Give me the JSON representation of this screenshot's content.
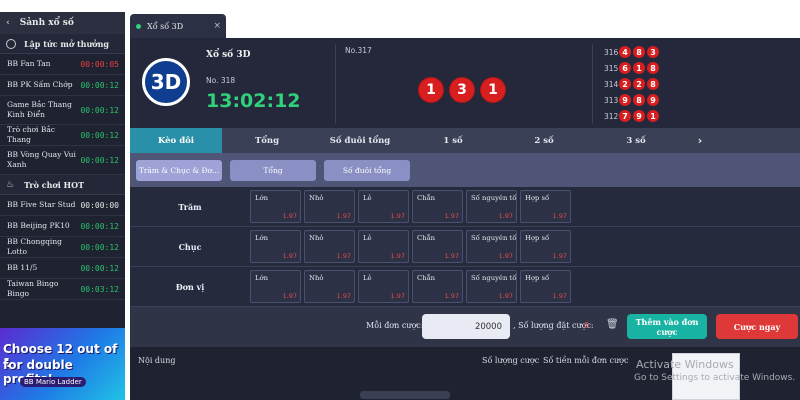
{
  "sidebar": {
    "title": "Sảnh xổ số",
    "sections": [
      {
        "title": "Lập tức mở thưởng",
        "icon": "clock-icon",
        "items": [
          {
            "name": "BB Fan Tan",
            "time": "00:00:05",
            "time_color": "red"
          },
          {
            "name": "BB PK Sấm Chớp",
            "time": "00:00:12",
            "time_color": "green"
          },
          {
            "name": "Game Bắc Thang Kinh Điển",
            "time": "00:00:12",
            "time_color": "green"
          },
          {
            "name": "Trò chơi Bắc Thang",
            "time": "00:00:12",
            "time_color": "green"
          },
          {
            "name": "BB Vòng Quay Vui Xanh",
            "time": "00:00:12",
            "time_color": "green"
          }
        ]
      },
      {
        "title": "Trò chơi HOT",
        "icon": "fire-icon",
        "items": [
          {
            "name": "BB Five Star Stud",
            "time": "00:00:00",
            "time_color": "white"
          },
          {
            "name": "BB Beijing PK10",
            "time": "00:00:12",
            "time_color": "green"
          },
          {
            "name": "BB Chongqing Lotto",
            "time": "00:00:12",
            "time_color": "green"
          },
          {
            "name": "BB 11/5",
            "time": "00:00:12",
            "time_color": "green"
          },
          {
            "name": "Taiwan Bingo Bingo",
            "time": "00:03:12",
            "time_color": "green"
          }
        ]
      }
    ],
    "promo": {
      "line1": "Choose 12 out of 1",
      "line2": "for double profits!",
      "line3": "BB Mario Ladder"
    }
  },
  "tab": {
    "label": "Xổ số 3D",
    "close": "×"
  },
  "game": {
    "logo_text": "3D",
    "title": "Xổ số 3D",
    "current_draw": "No. 318",
    "countdown": "13:02:12",
    "last_draw_label": "No.317",
    "last_result": [
      "1",
      "3",
      "1"
    ],
    "history": [
      {
        "no": "316",
        "balls": [
          "4",
          "8",
          "3"
        ]
      },
      {
        "no": "315",
        "balls": [
          "6",
          "1",
          "8"
        ]
      },
      {
        "no": "314",
        "balls": [
          "2",
          "2",
          "8"
        ]
      },
      {
        "no": "313",
        "balls": [
          "9",
          "8",
          "9"
        ]
      },
      {
        "no": "312",
        "balls": [
          "7",
          "9",
          "1"
        ]
      }
    ]
  },
  "categories": [
    "Kèo đôi",
    "Tổng",
    "Số đuôi tổng",
    "1 số",
    "2 số",
    "3 số",
    "›"
  ],
  "subtabs": [
    "Trăm & Chục & Đơ...",
    "Tổng",
    "Số đuôi tổng"
  ],
  "bet_rows": [
    {
      "label": "Trăm",
      "cells": [
        {
          "label": "Lớn",
          "odd": "1.97"
        },
        {
          "label": "Nhỏ",
          "odd": "1.97"
        },
        {
          "label": "Lẻ",
          "odd": "1.97"
        },
        {
          "label": "Chẵn",
          "odd": "1.97"
        },
        {
          "label": "Số nguyên tố",
          "odd": "1.97"
        },
        {
          "label": "Hợp số",
          "odd": "1.97"
        }
      ]
    },
    {
      "label": "Chục",
      "cells": [
        {
          "label": "Lớn",
          "odd": "1.97"
        },
        {
          "label": "Nhỏ",
          "odd": "1.97"
        },
        {
          "label": "Lẻ",
          "odd": "1.97"
        },
        {
          "label": "Chẵn",
          "odd": "1.97"
        },
        {
          "label": "Số nguyên tố",
          "odd": "1.97"
        },
        {
          "label": "Hợp số",
          "odd": "1.97"
        }
      ]
    },
    {
      "label": "Đơn vị",
      "cells": [
        {
          "label": "Lớn",
          "odd": "1.97"
        },
        {
          "label": "Nhỏ",
          "odd": "1.97"
        },
        {
          "label": "Lẻ",
          "odd": "1.97"
        },
        {
          "label": "Chẵn",
          "odd": "1.97"
        },
        {
          "label": "Số nguyên tố",
          "odd": "1.97"
        },
        {
          "label": "Hợp số",
          "odd": "1.97"
        }
      ]
    }
  ],
  "controls": {
    "per_bet_label": "Mỗi đơn cược:",
    "amount": "20000",
    "count_label": ", Số lượng đặt cược:",
    "count": "0",
    "add_label": "Thêm vào đơn cược",
    "bet_label": "Cược ngay"
  },
  "table": {
    "headers": [
      "Nội dung",
      "Số lượng cược",
      "Số tiền mỗi đơn cược"
    ]
  },
  "watermark": {
    "line1": "Activate Windows",
    "line2": "Go to Settings to activate Windows."
  },
  "colors": {
    "accent_teal": "#2a8fa8",
    "countdown_green": "#2fd17a",
    "ball_red": "#d71f1f",
    "bet_red": "#df3838",
    "add_teal": "#19b3a3"
  }
}
